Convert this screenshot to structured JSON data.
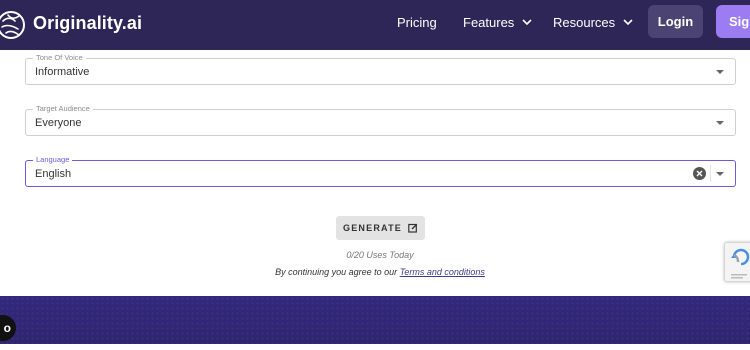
{
  "nav": {
    "brand": "Originality.ai",
    "pricing": "Pricing",
    "features": "Features",
    "resources": "Resources",
    "login": "Login",
    "signup": "Sign"
  },
  "form": {
    "tone": {
      "label": "Tone Of Voice",
      "value": "Informative"
    },
    "audience": {
      "label": "Target Audience",
      "value": "Everyone"
    },
    "language": {
      "label": "Language",
      "value": "English"
    },
    "generate_label": "GENERATE",
    "uses_today": "0/20 Uses Today",
    "terms_prefix": "By continuing you agree to our ",
    "terms_link": "Terms and conditions"
  },
  "chat": {
    "glyph": "o"
  },
  "colors": {
    "nav_bg": "#2f2658",
    "accent": "#6b5bd8",
    "signup_bg": "#9b7cf2",
    "footer_bg": "#33287a"
  },
  "icons": [
    "brain-logo-icon",
    "chevron-down-icon",
    "dropdown-caret-icon",
    "clear-icon",
    "edit-icon",
    "recaptcha-icon",
    "chat-icon"
  ]
}
